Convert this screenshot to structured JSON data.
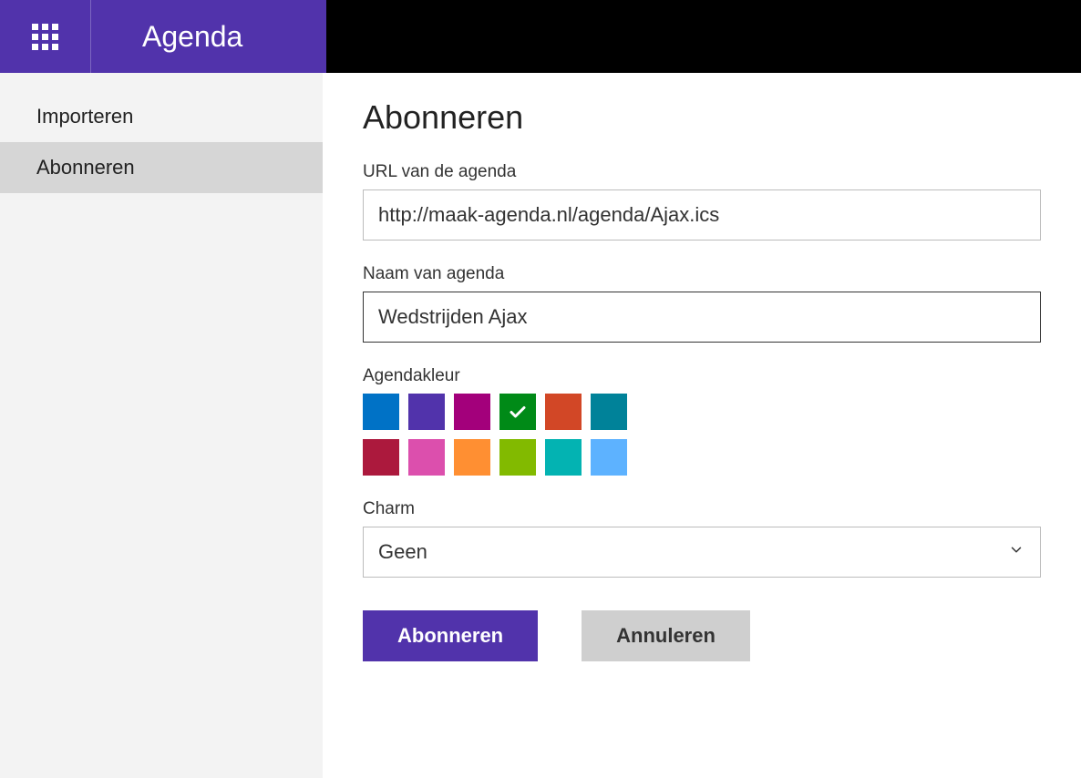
{
  "header": {
    "app_title": "Agenda"
  },
  "sidebar": {
    "items": [
      {
        "label": "Importeren",
        "active": false
      },
      {
        "label": "Abonneren",
        "active": true
      }
    ]
  },
  "main": {
    "title": "Abonneren",
    "url_label": "URL van de agenda",
    "url_value": "http://maak-agenda.nl/agenda/Ajax.ics",
    "name_label": "Naam van agenda",
    "name_value": "Wedstrijden Ajax",
    "color_label": "Agendakleur",
    "colors": [
      {
        "name": "blue",
        "hex": "#0072c6",
        "selected": false
      },
      {
        "name": "purple",
        "hex": "#5133ab",
        "selected": false
      },
      {
        "name": "magenta",
        "hex": "#a3007b",
        "selected": false
      },
      {
        "name": "green",
        "hex": "#008a17",
        "selected": true
      },
      {
        "name": "orange-red",
        "hex": "#d24726",
        "selected": false
      },
      {
        "name": "teal",
        "hex": "#008299",
        "selected": false
      },
      {
        "name": "crimson",
        "hex": "#ac193d",
        "selected": false
      },
      {
        "name": "pink",
        "hex": "#dc4fad",
        "selected": false
      },
      {
        "name": "orange",
        "hex": "#ff8f32",
        "selected": false
      },
      {
        "name": "lime",
        "hex": "#82ba00",
        "selected": false
      },
      {
        "name": "cyan",
        "hex": "#03b3b2",
        "selected": false
      },
      {
        "name": "sky",
        "hex": "#5db2ff",
        "selected": false
      }
    ],
    "charm_label": "Charm",
    "charm_value": "Geen",
    "submit_label": "Abonneren",
    "cancel_label": "Annuleren"
  }
}
